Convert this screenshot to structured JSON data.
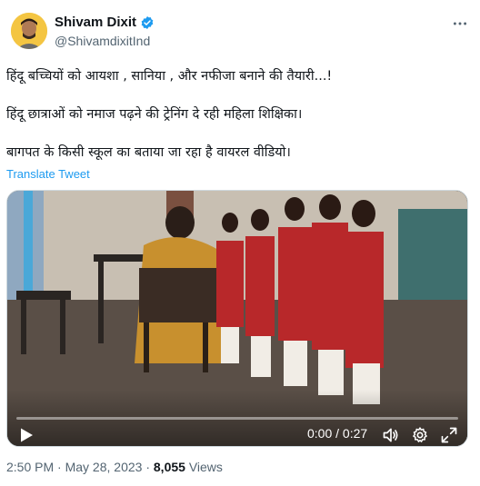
{
  "author": {
    "display_name": "Shivam Dixit",
    "handle": "@ShivamdixitInd",
    "verified_icon": "verified-badge-icon",
    "avatar_color": "#f4c542"
  },
  "more_icon": "more-horizontal-icon",
  "tweet": {
    "lines": [
      "हिंदू बच्चियों को आयशा , सानिया , और नफीजा बनाने की तैयारी...!",
      "हिंदू छात्राओं को नमाज पढ़ने की ट्रेनिंग दे रही महिला शिक्षिका।",
      "बागपत के किसी स्कूल का बताया जा रहा है वायरल वीडियो।"
    ],
    "translate_label": "Translate Tweet"
  },
  "video": {
    "time_display": "0:00 / 0:27",
    "progress": 0,
    "play_icon": "play-icon",
    "volume_icon": "volume-icon",
    "settings_icon": "gear-icon",
    "fullscreen_icon": "fullscreen-icon",
    "accent_color": "#1d9bf0"
  },
  "meta": {
    "time": "2:50 PM",
    "separator": " · ",
    "date": "May 28, 2023",
    "views_count": "8,055",
    "views_label": " Views"
  },
  "colors": {
    "text_primary": "#0f1419",
    "text_secondary": "#536471",
    "link": "#1d9bf0"
  }
}
